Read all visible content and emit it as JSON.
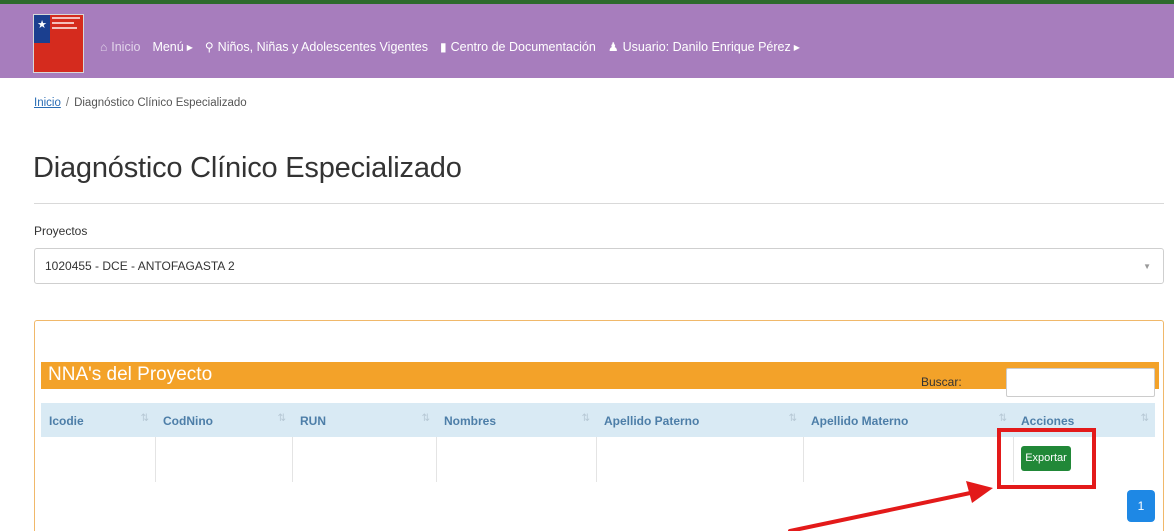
{
  "nav": {
    "inicio": "Inicio",
    "menu": "Menú",
    "ninos": "Niños, Niñas y Adolescentes Vigentes",
    "centro": "Centro de Documentación",
    "usuario": "Usuario: Danilo Enrique Pérez"
  },
  "breadcrumb": {
    "home": "Inicio",
    "separator": "/",
    "current": "Diagnóstico Clínico Especializado"
  },
  "page": {
    "title": "Diagnóstico Clínico Especializado"
  },
  "proyectos": {
    "label": "Proyectos",
    "selected": "1020455 - DCE - ANTOFAGASTA 2"
  },
  "panel": {
    "title": "NNA's del Proyecto",
    "search_label": "Buscar:",
    "search_value": ""
  },
  "table": {
    "columns": [
      "Icodie",
      "CodNino",
      "RUN",
      "Nombres",
      "Apellido Paterno",
      "Apellido Materno",
      "Acciones"
    ]
  },
  "actions": {
    "export_label": "Exportar"
  },
  "pagination": {
    "current_page": "1"
  },
  "colors": {
    "navbar": "#a77dbd",
    "panel_header": "#f3a229",
    "export_button": "#218838",
    "highlight": "#e31a1a",
    "pager": "#1e88e5"
  }
}
